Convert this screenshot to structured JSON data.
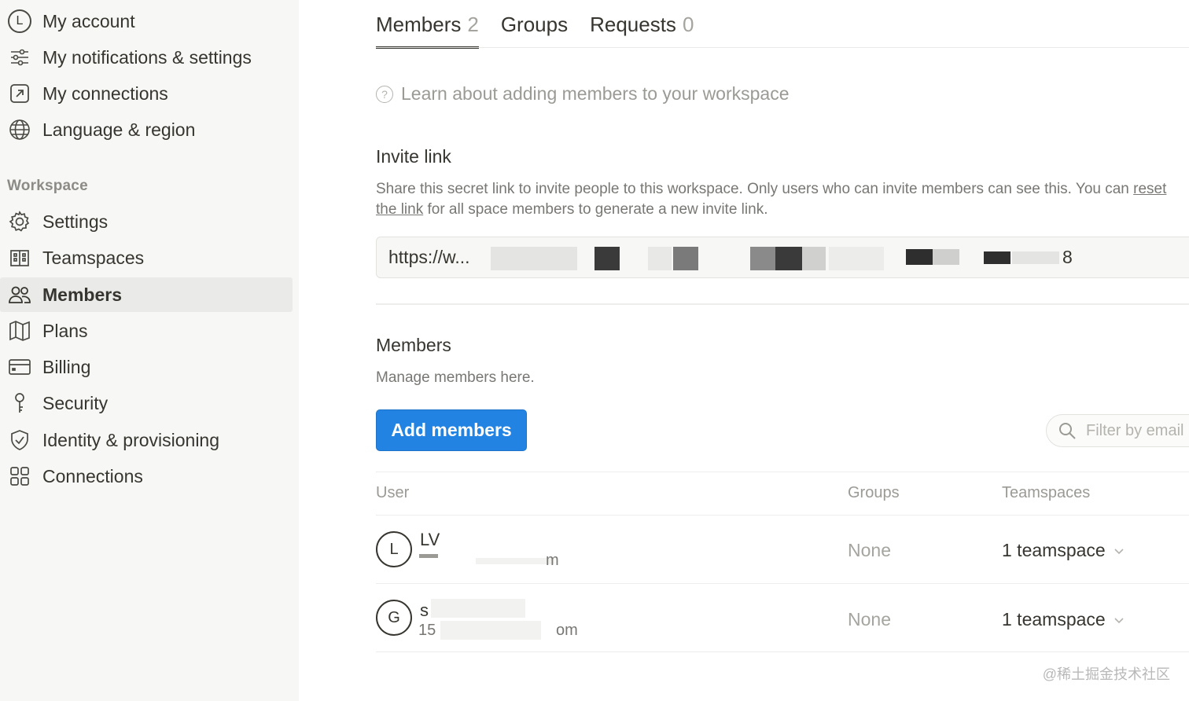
{
  "sidebar": {
    "account_items": [
      {
        "label": "My account",
        "avatar_letter": "L"
      },
      {
        "label": "My notifications & settings"
      },
      {
        "label": "My connections"
      },
      {
        "label": "Language & region"
      }
    ],
    "workspace_section_label": "Workspace",
    "workspace_items": [
      {
        "label": "Settings"
      },
      {
        "label": "Teamspaces"
      },
      {
        "label": "Members"
      },
      {
        "label": "Plans"
      },
      {
        "label": "Billing"
      },
      {
        "label": "Security"
      },
      {
        "label": "Identity & provisioning"
      },
      {
        "label": "Connections"
      }
    ]
  },
  "tabs": [
    {
      "label": "Members",
      "count": "2"
    },
    {
      "label": "Groups",
      "count": ""
    },
    {
      "label": "Requests",
      "count": "0"
    }
  ],
  "help_link": "Learn about adding members to your workspace",
  "invite": {
    "title": "Invite link",
    "desc_part1": "Share this secret link to invite people to this workspace. Only users who can invite members can see this. You can ",
    "desc_link": "reset the link",
    "desc_part2": " for all space members to generate a new invite link.",
    "url_visible_start": "https://w...",
    "url_visible_end": "8"
  },
  "members_section": {
    "title": "Members",
    "desc": "Manage members here.",
    "add_button": "Add members",
    "filter_placeholder": "Filter by email"
  },
  "table": {
    "headers": {
      "user": "User",
      "groups": "Groups",
      "teamspaces": "Teamspaces"
    },
    "rows": [
      {
        "avatar": "L",
        "name": "LV",
        "email_fragment": "m",
        "groups": "None",
        "teamspaces": "1 teamspace"
      },
      {
        "avatar": "G",
        "name": "s",
        "email_fragment": "om",
        "email_prefix": "15",
        "groups": "None",
        "teamspaces": "1 teamspace"
      }
    ]
  },
  "watermark": "@稀土掘金技术社区",
  "colors": {
    "accent": "#2383e2",
    "sidebar_bg": "#f7f7f5",
    "active_item_bg": "#eaeae8"
  }
}
